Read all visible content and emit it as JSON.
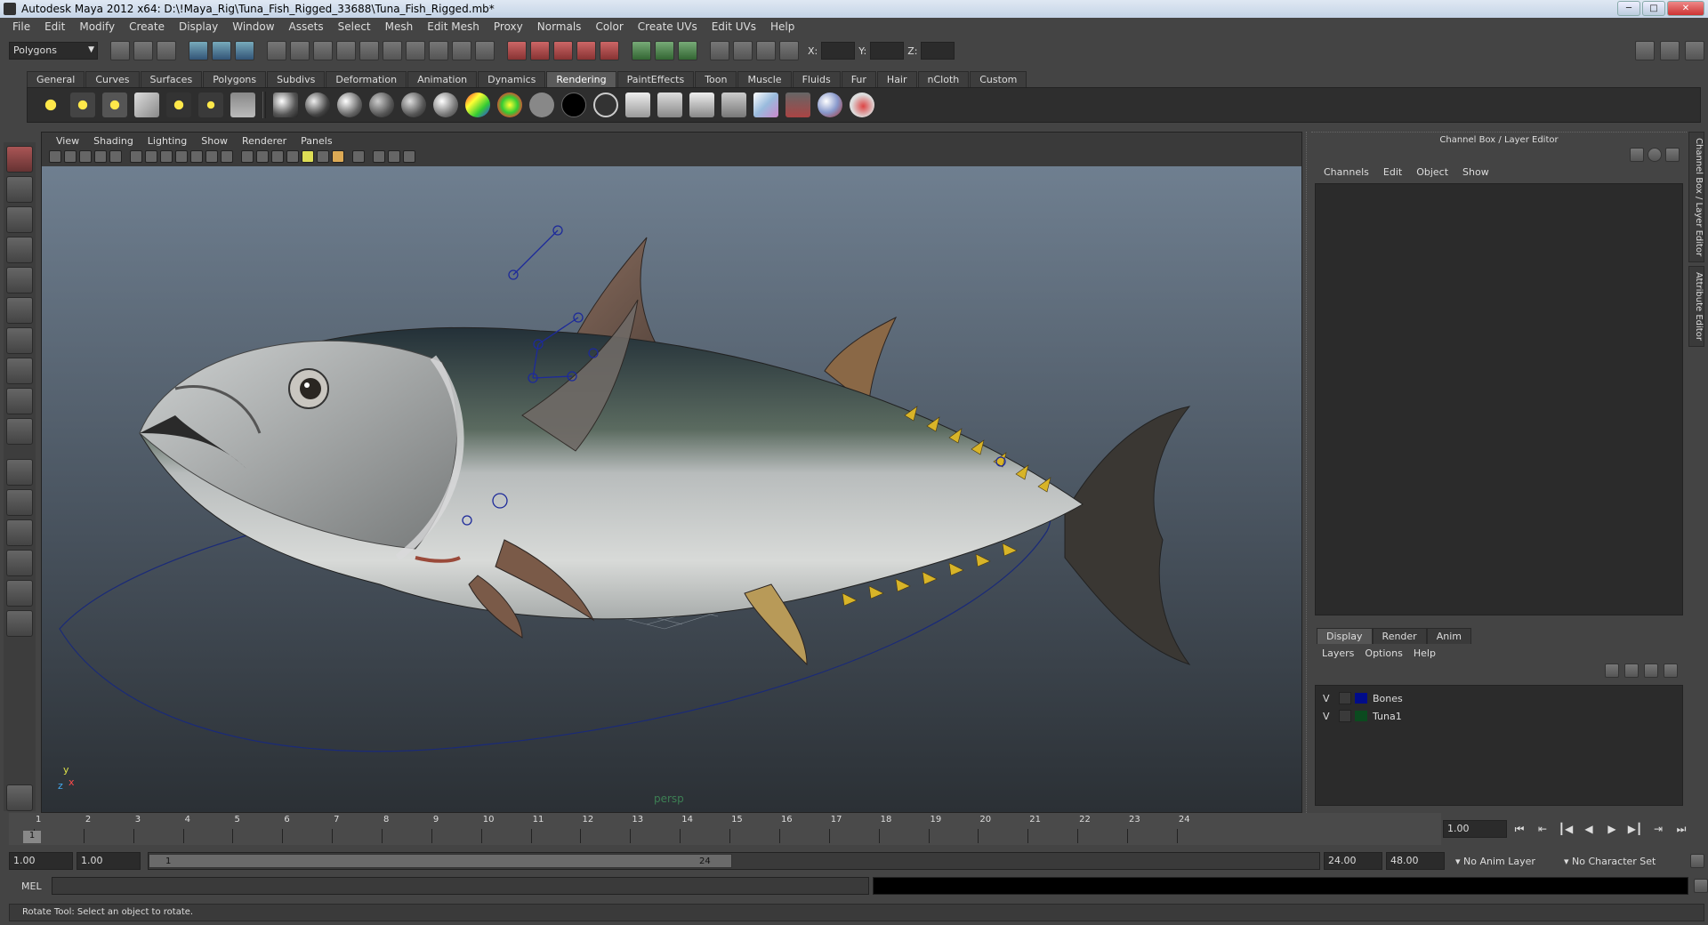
{
  "window": {
    "title": "Autodesk Maya 2012 x64: D:\\!Maya_Rig\\Tuna_Fish_Rigged_33688\\Tuna_Fish_Rigged.mb*",
    "minimize": "─",
    "maximize": "□",
    "close": "✕"
  },
  "menubar": [
    "File",
    "Edit",
    "Modify",
    "Create",
    "Display",
    "Window",
    "Assets",
    "Select",
    "Mesh",
    "Edit Mesh",
    "Proxy",
    "Normals",
    "Color",
    "Create UVs",
    "Edit UVs",
    "Help"
  ],
  "statusline": {
    "mode": "Polygons",
    "x_label": "X:",
    "y_label": "Y:",
    "z_label": "Z:"
  },
  "shelf": {
    "tabs": [
      "General",
      "Curves",
      "Surfaces",
      "Polygons",
      "Subdivs",
      "Deformation",
      "Animation",
      "Dynamics",
      "Rendering",
      "PaintEffects",
      "Toon",
      "Muscle",
      "Fluids",
      "Fur",
      "Hair",
      "nCloth",
      "Custom"
    ],
    "active_tab": "Rendering"
  },
  "viewport": {
    "panel_menu": [
      "View",
      "Shading",
      "Lighting",
      "Show",
      "Renderer",
      "Panels"
    ],
    "camera_label": "persp",
    "axis_y": "y",
    "axis_x": "x",
    "axis_z": "z"
  },
  "channel_box": {
    "title": "Channel Box / Layer Editor",
    "menu": [
      "Channels",
      "Edit",
      "Object",
      "Show"
    ]
  },
  "layer_editor": {
    "tabs": [
      "Display",
      "Render",
      "Anim"
    ],
    "active_tab": "Display",
    "menu": [
      "Layers",
      "Options",
      "Help"
    ],
    "layers": [
      {
        "visible": "V",
        "name": "Bones",
        "color": "#000c8a"
      },
      {
        "visible": "V",
        "name": "Tuna1",
        "color": "#0b4a1f"
      }
    ]
  },
  "side_tabs": [
    "Channel Box / Layer Editor",
    "Attribute Editor"
  ],
  "timeline": {
    "ticks": [
      "1",
      "2",
      "3",
      "4",
      "5",
      "6",
      "7",
      "8",
      "9",
      "10",
      "11",
      "12",
      "13",
      "14",
      "15",
      "16",
      "17",
      "18",
      "19",
      "20",
      "21",
      "22",
      "23",
      "24"
    ],
    "current_frame": "1",
    "current_time_field": "1.00"
  },
  "playback": [
    "⏮",
    "⇤",
    "┃◀",
    "◀",
    "▶",
    "▶┃",
    "⇥",
    "⏭"
  ],
  "range": {
    "start_time": "1.00",
    "playback_start": "1.00",
    "range_start_label": "1",
    "range_end_label": "24",
    "playback_end": "24.00",
    "end_time": "48.00",
    "anim_layer": "No Anim Layer",
    "character_set": "No Character Set"
  },
  "command_line": {
    "label": "MEL"
  },
  "help_line": "Rotate Tool: Select an object to rotate."
}
